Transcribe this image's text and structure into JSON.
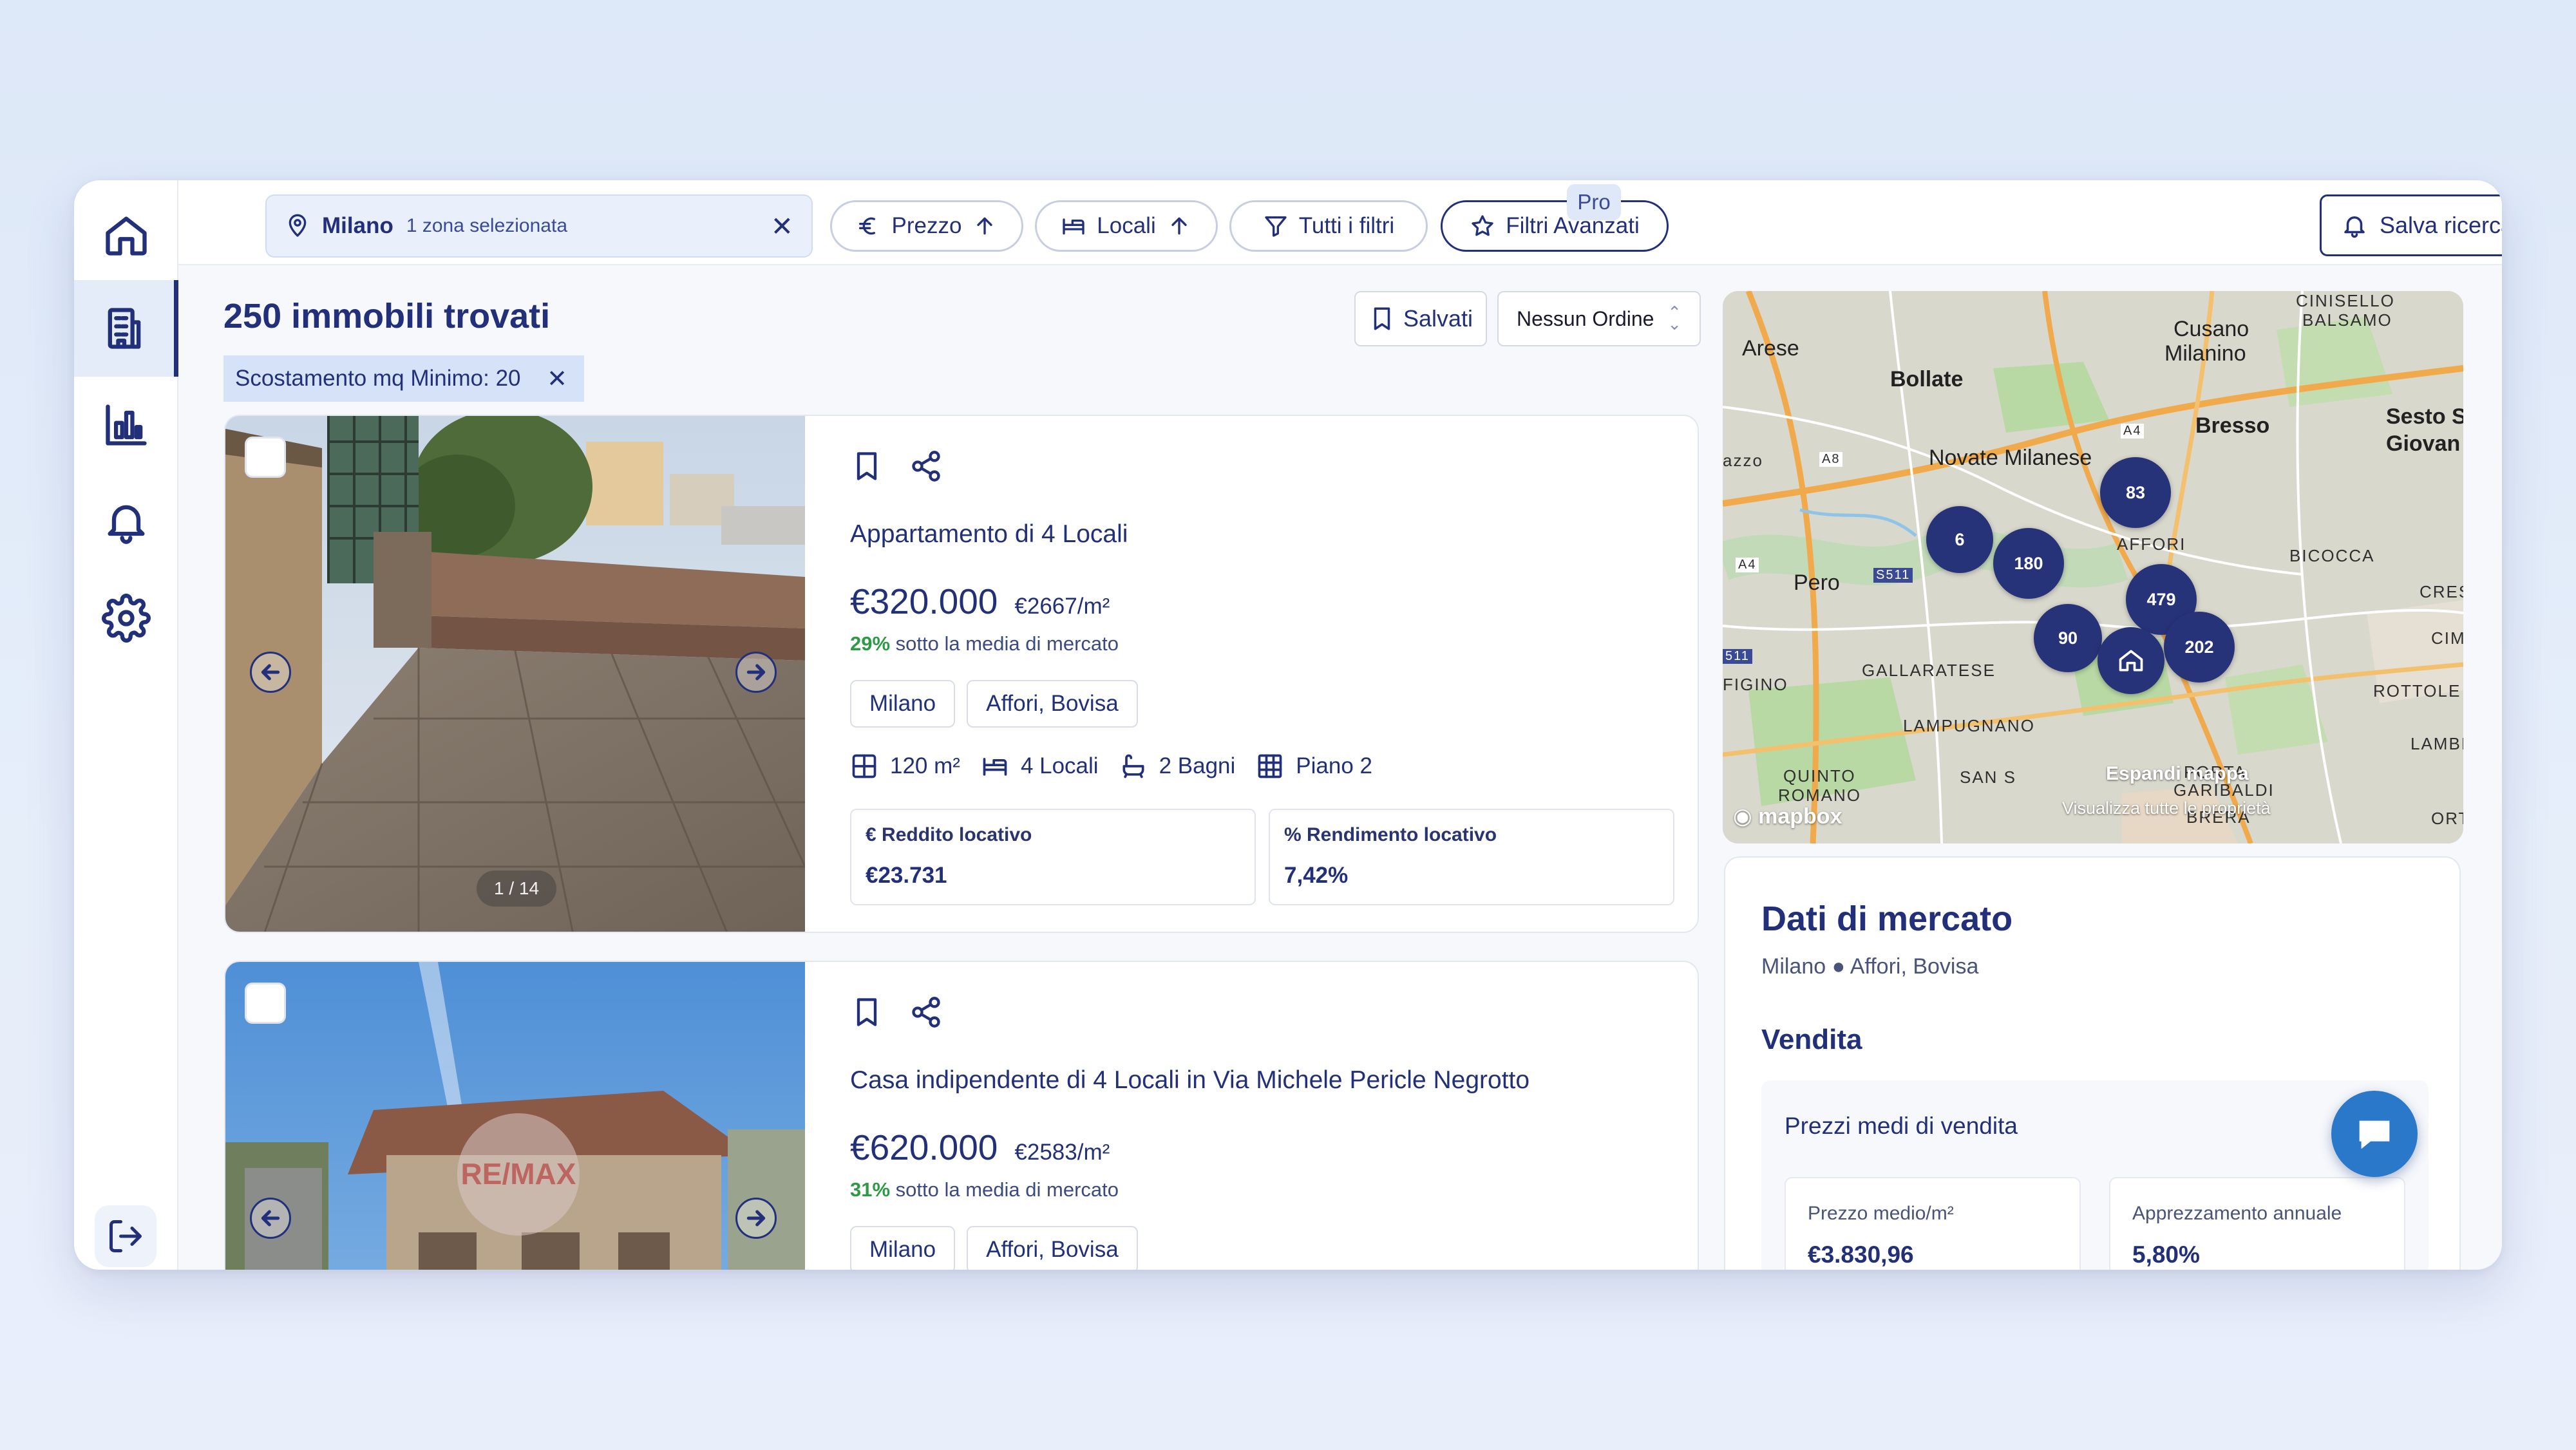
{
  "topbar": {
    "location_city": "Milano",
    "location_sub": "1 zona selezionata",
    "location_clear": "✕",
    "price_filter": "Prezzo",
    "rooms_filter": "Locali",
    "all_filters": "Tutti i filtri",
    "advanced_filters": "Filtri Avanzati",
    "pro_badge": "Pro",
    "save_search": "Salva ricerca"
  },
  "list": {
    "results_title": "250 immobili trovati",
    "active_chip": "Scostamento mq Minimo: 20",
    "chip_remove": "✕",
    "saved_button": "Salvati",
    "sort_value": "Nessun Ordine"
  },
  "listings": [
    {
      "photo_counter": "1 / 14",
      "title": "Appartamento di 4 Locali",
      "price": "€320.000",
      "price_sqm": "€2667/m²",
      "below_pct": "29%",
      "below_text": " sotto la media di mercato",
      "tags": [
        "Milano",
        "Affori, Bovisa"
      ],
      "area": "120 m²",
      "rooms": "4 Locali",
      "baths": "2 Bagni",
      "floor": "Piano 2",
      "income_label": "Reddito locativo",
      "income_value": "€23.731",
      "yield_label": "Rendimento locativo",
      "yield_value": "7,42%"
    },
    {
      "title": "Casa indipendente di 4 Locali in Via Michele Pericle Negrotto",
      "price": "€620.000",
      "price_sqm": "€2583/m²",
      "below_pct": "31%",
      "below_text": " sotto la media di mercato",
      "tags": [
        "Milano",
        "Affori, Bovisa"
      ],
      "photo_watermark": "RE/MAX"
    }
  ],
  "map": {
    "places": {
      "arese": "Arese",
      "bollate": "Bollate",
      "cusano": "Cusano",
      "milanino": "Milanino",
      "cinisello": "CINISELLO",
      "balsamo": "BALSAMO",
      "bresso": "Bresso",
      "sesto1": "Sesto S",
      "sesto2": "Giovan",
      "novate": "Novate Milanese",
      "pero": "Pero",
      "gallaratese": "GALLARATESE",
      "lampugnano": "LAMPUGNANO",
      "quinto": "QUINTO",
      "romano": "ROMANO",
      "figino": "FIGINO",
      "bicocca": "BICOCCA",
      "affori": "AFFORI",
      "rottole": "ROTTOLE",
      "lambr": "LAMBI",
      "garibaldi": "GARIBALDI",
      "porta": "PORTA",
      "brera": "BRERA",
      "san_s": "SAN S",
      "azzo": "azzo",
      "cres": "CRES",
      "cim": "CIM",
      "ort": "ORT",
      "a4": "A4",
      "a8": "A8",
      "s511": "S511",
      "e511": "511",
      "a4b": "A4"
    },
    "clusters": [
      "6",
      "180",
      "83",
      "479",
      "90",
      "202"
    ],
    "expand_label": "Espandi mappa",
    "expand_sub": "Visualizza tutte le proprietà",
    "attribution": "mapbox"
  },
  "market": {
    "title": "Dati di mercato",
    "subtitle": "Milano ● Affori, Bovisa",
    "section": "Vendita",
    "avg_title": "Prezzi medi di vendita",
    "avg_price_label": "Prezzo medio/m²",
    "avg_price_value": "€3.830,96",
    "appreciation_label": "Apprezzamento annuale",
    "appreciation_value": "5,80%"
  }
}
